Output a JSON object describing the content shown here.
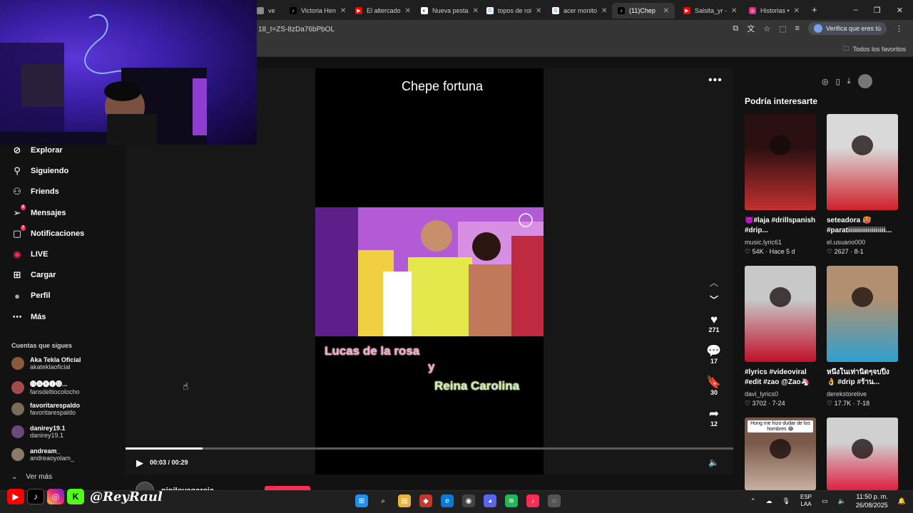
{
  "browser": {
    "tabs": [
      {
        "label": "ve",
        "icon": "generic-tab-icon",
        "active": false
      },
      {
        "label": "Victoria Hen",
        "icon": "tiktok-icon",
        "active": false
      },
      {
        "label": "El altercado",
        "icon": "youtube-icon",
        "active": false
      },
      {
        "label": "Nueva pesta",
        "icon": "github-icon",
        "active": false
      },
      {
        "label": "topos de roi",
        "icon": "google-icon",
        "active": false
      },
      {
        "label": "acer monito",
        "icon": "google-icon",
        "active": false
      },
      {
        "label": "(11)Chep",
        "icon": "tiktok-icon",
        "active": true
      },
      {
        "label": "Salsita_yr -",
        "icon": "youtube-icon",
        "active": false
      },
      {
        "label": "Historias •",
        "icon": "instagram-icon",
        "active": false
      }
    ],
    "url": "18_t=ZS-8zDa76bPbOL",
    "verify_label": "Verifica que eres tú",
    "all_favorites": "Todos los favoritos"
  },
  "sidebar": {
    "items": [
      {
        "label": "Explorar",
        "icon": "compass-icon",
        "badge": ""
      },
      {
        "label": "Siguiendo",
        "icon": "user-follow-icon",
        "badge": ""
      },
      {
        "label": "Friends",
        "icon": "friends-icon",
        "badge": ""
      },
      {
        "label": "Mensajes",
        "icon": "paper-plane-icon",
        "badge": "4"
      },
      {
        "label": "Notificaciones",
        "icon": "inbox-icon",
        "badge": "7"
      },
      {
        "label": "LIVE",
        "icon": "live-icon",
        "badge": ""
      },
      {
        "label": "Cargar",
        "icon": "upload-plus-icon",
        "badge": ""
      },
      {
        "label": "Perfil",
        "icon": "profile-avatar",
        "badge": ""
      },
      {
        "label": "Más",
        "icon": "more-dots-icon",
        "badge": ""
      }
    ],
    "following_title": "Cuentas que sigues",
    "accounts": [
      {
        "name": "Aka Tekla Oficial",
        "handle": "akateklaoficial",
        "color": "#8a5a3c"
      },
      {
        "name": "🅜🅐🅡🅘🅞...",
        "handle": "fansdeltiocolocho",
        "color": "#a34a4a"
      },
      {
        "name": "favoritarespaldo",
        "handle": "favoritarespaldo",
        "color": "#7a6a5a"
      },
      {
        "name": "danirey19.1",
        "handle": "danirey19.1",
        "color": "#6a4a7a"
      },
      {
        "name": "andream_",
        "handle": "andreaoyolam_",
        "color": "#8a7a6a"
      }
    ],
    "see_more": "Ver más"
  },
  "video": {
    "title": "Chepe fortuna",
    "caption_line1": "Lucas de la rosa",
    "caption_line2": "y",
    "caption_line3": "Reina Carolina",
    "current_time": "00:03 / 00:29",
    "progress": 0.127,
    "author": "ninilovegarcia",
    "actions": {
      "likes": "271",
      "comments": "17",
      "saves": "30",
      "shares": "12"
    }
  },
  "recommended": {
    "title": "Podría interesarte",
    "cards": [
      {
        "desc": "👿#laja #drillspanish #drip...",
        "user": "music.lyric61",
        "stats": "♡ 54K · Hace 5 d",
        "colors": [
          "#2a1010",
          "#c43030"
        ]
      },
      {
        "desc": "seteadora 🥵 #paratiiiiiiiiiiiiiiiiiii...",
        "user": "el.usuario000",
        "stats": "♡ 2627 · 8-1",
        "colors": [
          "#d9d9d9",
          "#d0202a"
        ]
      },
      {
        "desc": "#lyrics #videoviral #edit #zao @Zao🦄",
        "user": "davi_lyrics0",
        "stats": "♡ 3702 · 7-24",
        "colors": [
          "#c8c8c8",
          "#c0102a"
        ]
      },
      {
        "desc": "หนึ่งในเท่านิดๆจบปิ้ง👌 #drip #ร้าน...",
        "user": "derekstorelive",
        "stats": "♡ 17.7K · 7-18",
        "colors": [
          "#b09070",
          "#30a0d0"
        ]
      },
      {
        "desc": "",
        "user": "",
        "stats": "",
        "colors": [
          "#7a5a4a",
          "#c8b0a0"
        ],
        "overlay": "Hong me hizo dudar de los hombres 😂"
      },
      {
        "desc": "",
        "user": "",
        "stats": "",
        "colors": [
          "#d0d0d0",
          "#e02040"
        ]
      }
    ]
  },
  "stream": {
    "brand": "@ReyRaul"
  },
  "taskbar": {
    "lang_top": "ESP",
    "lang_bottom": "LAA",
    "time": "11:50 p. m.",
    "date": "26/08/2025"
  }
}
